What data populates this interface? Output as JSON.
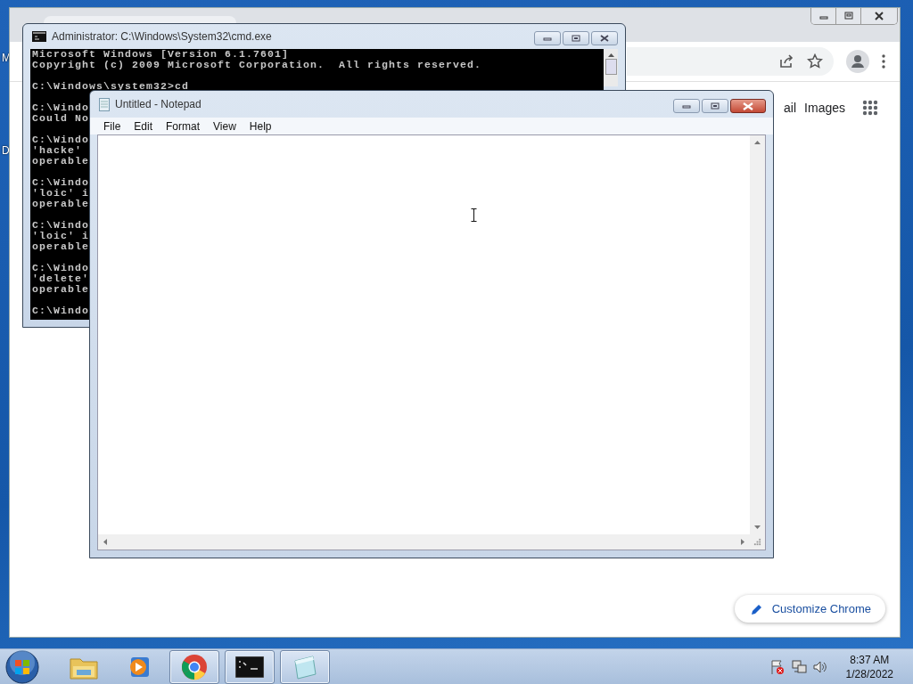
{
  "desktop": {
    "icon_labels": [
      "M",
      "D"
    ]
  },
  "browser": {
    "links": [
      "ail",
      "Images"
    ],
    "customize_button": "Customize Chrome"
  },
  "console_window": {
    "title": "Administrator: C:\\Windows\\System32\\cmd.exe",
    "blocks": [
      [
        "Microsoft Windows [Version 6.1.7601]",
        "Copyright (c) 2009 Microsoft Corporation.  All rights reserved."
      ],
      [
        "C:\\Windows\\system32>cd"
      ],
      [
        "C:\\Windo",
        "Could No"
      ],
      [
        "C:\\Windo",
        "'hacke'",
        "operable"
      ],
      [
        "C:\\Windo",
        "'loic' i",
        "operable"
      ],
      [
        "C:\\Windo",
        "'loic' i",
        "operable"
      ],
      [
        "C:\\Windo",
        "'delete'",
        "operable"
      ],
      [
        "C:\\Windo"
      ]
    ]
  },
  "notepad": {
    "title": "Untitled - Notepad",
    "menu": [
      "File",
      "Edit",
      "Format",
      "View",
      "Help"
    ]
  },
  "taskbar": {
    "items": [
      {
        "kind": "explorer",
        "running": false
      },
      {
        "kind": "media",
        "running": false
      },
      {
        "kind": "chrome",
        "running": true
      },
      {
        "kind": "console",
        "running": true
      },
      {
        "kind": "notepad",
        "running": true
      }
    ],
    "time": "8:37 AM",
    "date": "1/28/2022"
  }
}
